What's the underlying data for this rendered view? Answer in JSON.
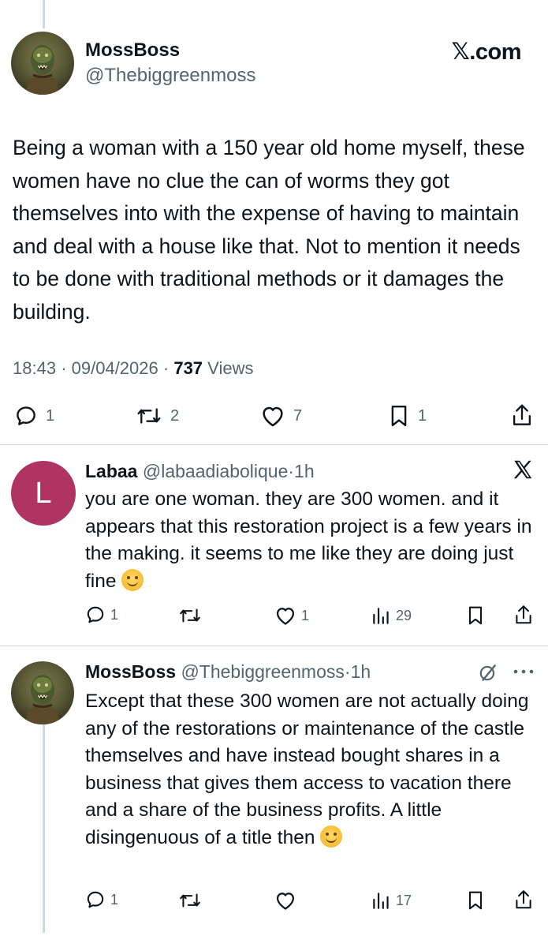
{
  "main_tweet": {
    "display_name": "MossBoss",
    "handle": "@Thebiggreenmoss",
    "brand": "𝕏.com",
    "text": "Being a woman with a 150 year old home myself, these women have no clue the can of worms they got themselves into with the expense of having to maintain and deal with a house like that. Not to mention it needs to be done with traditional methods or it damages the building.",
    "time": "18:43",
    "sep1": "·",
    "date": "09/04/2026",
    "sep2": "·",
    "views_count": "737",
    "views_label": "Views",
    "replies": "1",
    "reposts": "2",
    "likes": "7",
    "bookmarks": "1"
  },
  "replies": [
    {
      "avatar_letter": "L",
      "avatar_color": "#b03462",
      "display_name": "Labaa",
      "handle": "@labaadiabolique",
      "sep": "·",
      "age": "1h",
      "text": "you are one woman. they are 300 women. and it appears that this restoration project is a few years in the making. it seems to me like they are doing just fine",
      "emoji": "smiling-face",
      "replies": "1",
      "reposts": "",
      "likes": "1",
      "views": "29"
    },
    {
      "display_name": "MossBoss",
      "handle": "@Thebiggreenmoss",
      "sep": "·",
      "age": "1h",
      "text": "Except that these 300 women are not actually doing any of the restorations or maintenance of the castle themselves and have instead bought shares in a business that gives them access to vacation there and a share of the business profits. A little disingenuous of a title then",
      "emoji": "smiling-face",
      "replies": "1",
      "reposts": "",
      "likes": "",
      "views": "17"
    }
  ],
  "colors": {
    "text": "#0f1419",
    "muted": "#536471",
    "divider": "#cfd9de"
  }
}
